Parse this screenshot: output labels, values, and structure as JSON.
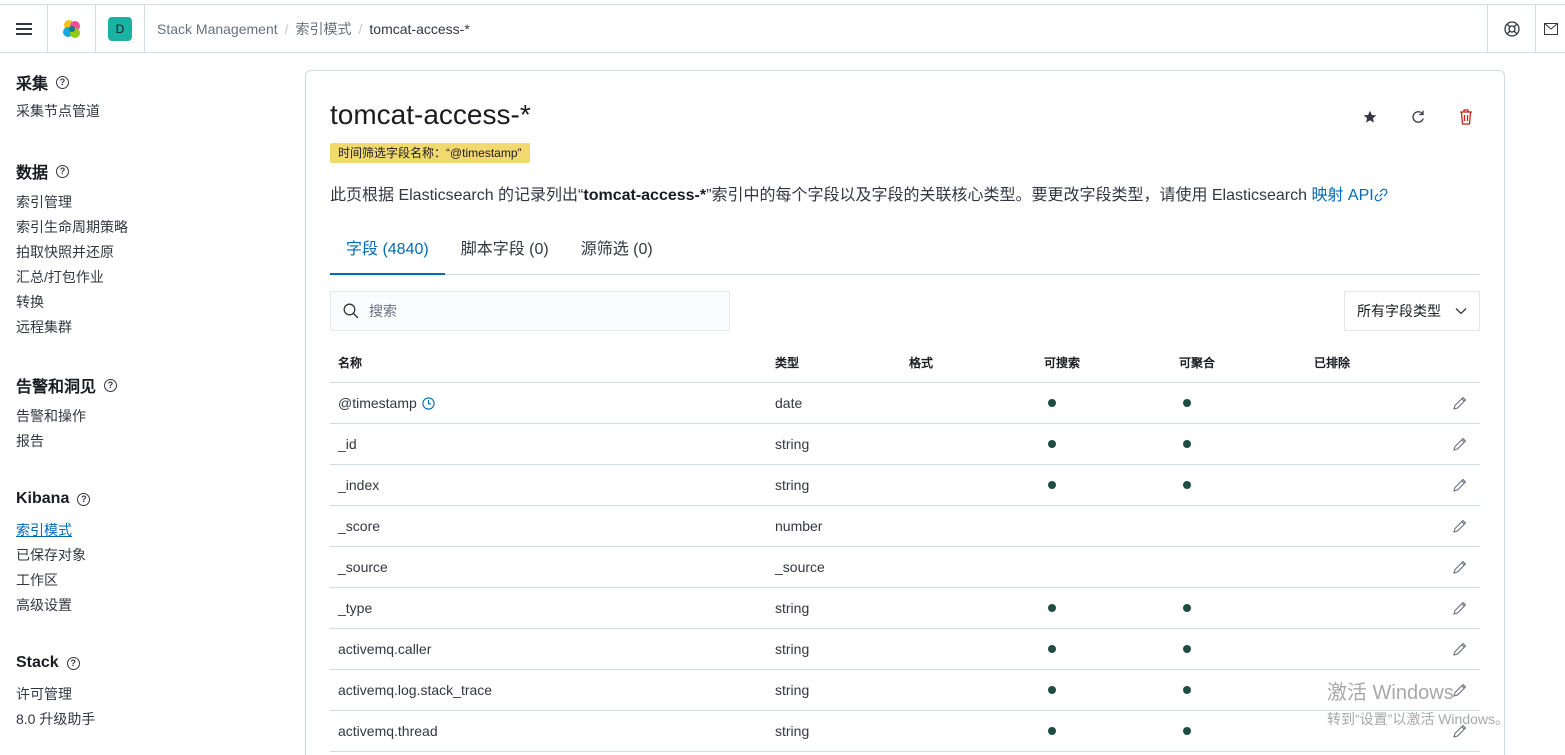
{
  "header": {
    "space_initial": "D",
    "breadcrumbs": [
      "Stack Management",
      "索引模式",
      "tomcat-access-*"
    ]
  },
  "sidebar": {
    "groups": [
      {
        "title": "采集",
        "items": [
          "采集节点管道"
        ]
      },
      {
        "title": "数据",
        "items": [
          "索引管理",
          "索引生命周期策略",
          "拍取快照并还原",
          "汇总/打包作业",
          "转换",
          "远程集群"
        ]
      },
      {
        "title": "告警和洞见",
        "items": [
          "告警和操作",
          "报告"
        ]
      },
      {
        "title": "Kibana",
        "items": [
          "索引模式",
          "已保存对象",
          "工作区",
          "高级设置"
        ]
      },
      {
        "title": "Stack",
        "items": [
          "许可管理",
          "8.0 升级助手"
        ]
      }
    ],
    "active_item": "索引模式"
  },
  "page": {
    "title": "tomcat-access-*",
    "badge": "时间筛选字段名称：“@timestamp”",
    "desc_prefix": "此页根据 Elasticsearch 的记录列出“",
    "desc_bold": "tomcat-access-*",
    "desc_suffix": "”索引中的每个字段以及字段的关联核心类型。要更改字段类型，请使用 Elasticsearch ",
    "desc_link": "映射 API"
  },
  "tabs": [
    "字段 (4840)",
    "脚本字段 (0)",
    "源筛选 (0)"
  ],
  "search": {
    "placeholder": "搜索",
    "value": ""
  },
  "filter": {
    "label": "所有字段类型"
  },
  "table": {
    "headers": [
      "名称",
      "类型",
      "格式",
      "可搜索",
      "可聚合",
      "已排除"
    ],
    "rows": [
      {
        "name": "@timestamp",
        "type": "date",
        "searchable": true,
        "aggregatable": true
      },
      {
        "name": "_id",
        "type": "string",
        "searchable": true,
        "aggregatable": true
      },
      {
        "name": "_index",
        "type": "string",
        "searchable": true,
        "aggregatable": true
      },
      {
        "name": "_score",
        "type": "number",
        "searchable": false,
        "aggregatable": false
      },
      {
        "name": "_source",
        "type": "_source",
        "searchable": false,
        "aggregatable": false
      },
      {
        "name": "_type",
        "type": "string",
        "searchable": true,
        "aggregatable": true
      },
      {
        "name": "activemq.caller",
        "type": "string",
        "searchable": true,
        "aggregatable": true
      },
      {
        "name": "activemq.log.stack_trace",
        "type": "string",
        "searchable": true,
        "aggregatable": true
      },
      {
        "name": "activemq.thread",
        "type": "string",
        "searchable": true,
        "aggregatable": true
      }
    ]
  },
  "watermark": {
    "line1": "激活 Windows",
    "line2": "转到“设置”以激活 Windows。"
  }
}
